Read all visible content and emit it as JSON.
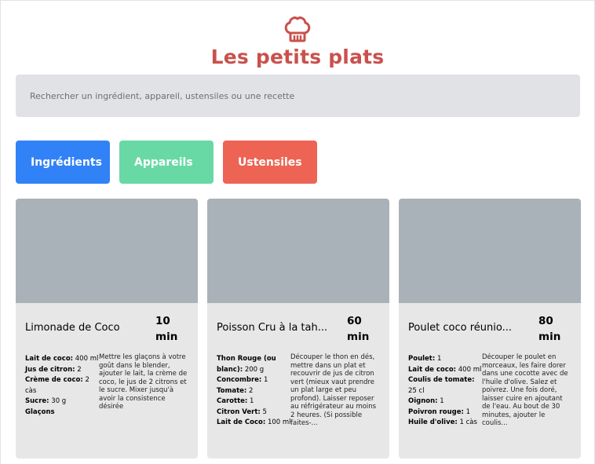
{
  "header": {
    "title": "Les petits plats",
    "logo_icon": "chef-hat-icon",
    "accent_color": "#C9514D"
  },
  "search": {
    "placeholder": "Rechercher un ingrédient, appareil, ustensiles ou une recette",
    "value": ""
  },
  "filters": [
    {
      "label": "Ingrédients",
      "color": "#3282F7"
    },
    {
      "label": "Appareils",
      "color": "#68D9A4"
    },
    {
      "label": "Ustensiles",
      "color": "#ED6454"
    }
  ],
  "recipes": [
    {
      "name": "Limonade de Coco",
      "time_value": "10",
      "time_unit": "min",
      "ingredients": [
        {
          "name": "Lait de coco:",
          "qty": "400 ml"
        },
        {
          "name": "Jus de citron:",
          "qty": "2"
        },
        {
          "name": "Crème de coco:",
          "qty": "2 càs"
        },
        {
          "name": "Sucre:",
          "qty": "30 g"
        },
        {
          "name": "Glaçons",
          "qty": ""
        }
      ],
      "description": "Mettre les glaçons à votre goût dans le blender, ajouter le lait, la crème de coco, le jus de 2 citrons et le sucre. Mixer jusqu'à avoir la consistence désirée"
    },
    {
      "name": "Poisson Cru à la tah...",
      "time_value": "60",
      "time_unit": "min",
      "ingredients": [
        {
          "name": "Thon Rouge (ou blanc):",
          "qty": "200 g"
        },
        {
          "name": "Concombre:",
          "qty": "1"
        },
        {
          "name": "Tomate:",
          "qty": "2"
        },
        {
          "name": "Carotte:",
          "qty": "1"
        },
        {
          "name": "Citron Vert:",
          "qty": "5"
        },
        {
          "name": "Lait de Coco:",
          "qty": "100 ml"
        }
      ],
      "description": "Découper le thon en dés, mettre dans un plat et recouvrir de jus de citron vert (mieux vaut prendre un plat large et peu profond). Laisser reposer au réfrigérateur au moins 2 heures. (Si possible faites-..."
    },
    {
      "name": "Poulet coco réunio...",
      "time_value": "80",
      "time_unit": "min",
      "ingredients": [
        {
          "name": "Poulet:",
          "qty": "1"
        },
        {
          "name": "Lait de coco:",
          "qty": "400 ml"
        },
        {
          "name": "Coulis de tomate:",
          "qty": "25 cl"
        },
        {
          "name": "Oignon:",
          "qty": "1"
        },
        {
          "name": "Poivron rouge:",
          "qty": "1"
        },
        {
          "name": "Huile d'olive:",
          "qty": "1 càs"
        }
      ],
      "description": "Découper le poulet en morceaux, les faire dorer dans une cocotte avec de l'huile d'olive. Salez et poivrez. Une fois doré, laisser cuire en ajoutant de l'eau. Au bout de 30 minutes, ajouter le coulis..."
    }
  ]
}
